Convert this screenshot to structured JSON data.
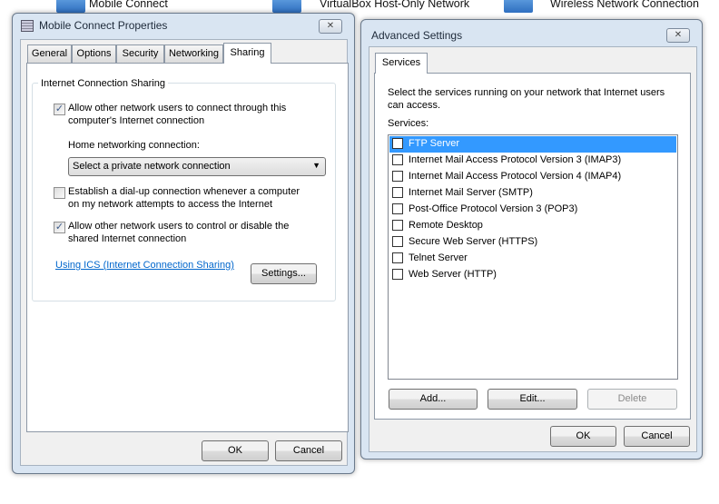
{
  "background": {
    "items": [
      {
        "label": "Mobile Connect"
      },
      {
        "label": "VirtualBox Host-Only Network"
      },
      {
        "label": "Wireless Network Connection"
      }
    ]
  },
  "properties_dialog": {
    "title": "Mobile Connect Properties",
    "close": "✕",
    "tabs": [
      "General",
      "Options",
      "Security",
      "Networking",
      "Sharing"
    ],
    "active_tab": "Sharing",
    "group_title": "Internet Connection Sharing",
    "allow_connect": {
      "label_line1": "Allow other network users to connect through this",
      "label_line2": "computer's Internet connection",
      "checked": true
    },
    "home_label": "Home networking connection:",
    "home_select": "Select a private network connection",
    "dialup": {
      "label_line1": "Establish a dial-up connection whenever a computer",
      "label_line2": "on my network attempts to access the Internet",
      "checked": false
    },
    "allow_control": {
      "label_line1": "Allow other network users to control or disable the",
      "label_line2": "shared Internet connection",
      "checked": true
    },
    "ics_link": "Using ICS (Internet Connection Sharing)",
    "settings_button": "Settings...",
    "ok": "OK",
    "cancel": "Cancel"
  },
  "advanced_dialog": {
    "title": "Advanced Settings",
    "close": "✕",
    "tab": "Services",
    "description_line1": "Select the services running on your network that Internet users",
    "description_line2": "can access.",
    "services_label": "Services:",
    "services": [
      {
        "label": "FTP Server",
        "checked": false,
        "selected": true
      },
      {
        "label": "Internet Mail Access Protocol Version 3 (IMAP3)",
        "checked": false
      },
      {
        "label": "Internet Mail Access Protocol Version 4 (IMAP4)",
        "checked": false
      },
      {
        "label": "Internet Mail Server (SMTP)",
        "checked": false
      },
      {
        "label": "Post-Office Protocol Version 3 (POP3)",
        "checked": false
      },
      {
        "label": "Remote Desktop",
        "checked": false
      },
      {
        "label": "Secure Web Server (HTTPS)",
        "checked": false
      },
      {
        "label": "Telnet Server",
        "checked": false
      },
      {
        "label": "Web Server (HTTP)",
        "checked": false
      }
    ],
    "add": "Add...",
    "edit": "Edit...",
    "delete": "Delete",
    "ok": "OK",
    "cancel": "Cancel"
  },
  "colors": {
    "selection": "#3399ff",
    "link": "#0066cc"
  }
}
